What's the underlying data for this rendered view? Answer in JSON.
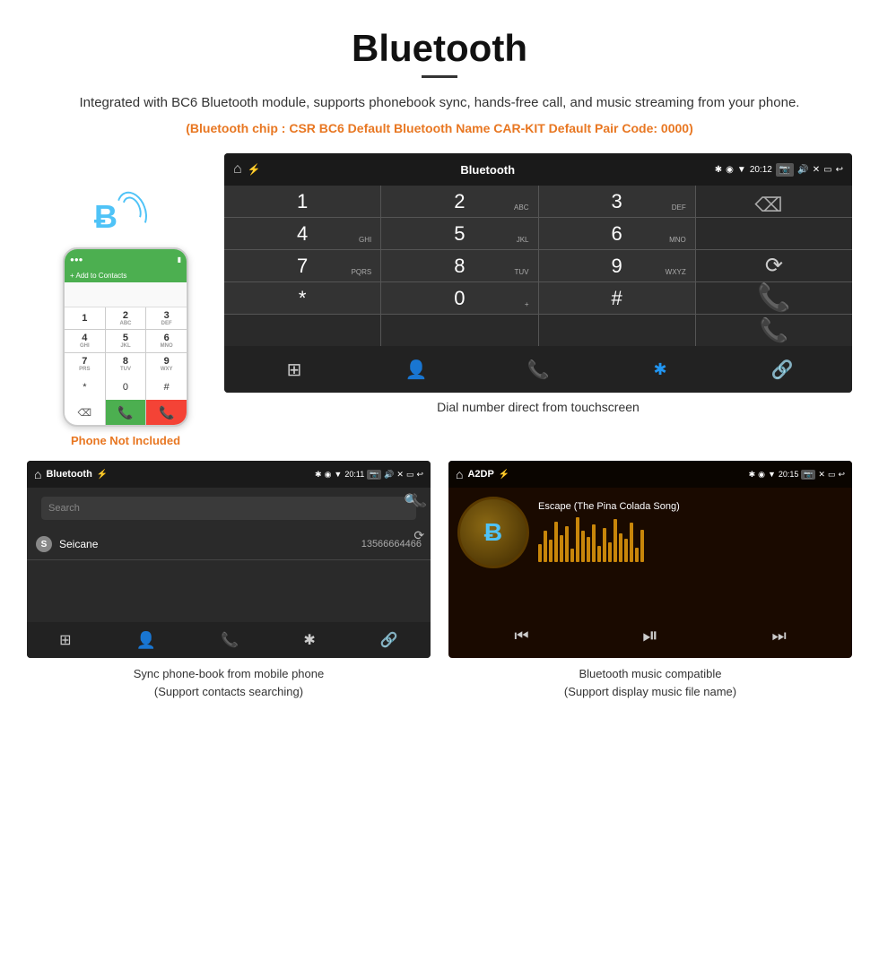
{
  "header": {
    "title": "Bluetooth",
    "description": "Integrated with BC6 Bluetooth module, supports phonebook sync, hands-free call, and music streaming from your phone.",
    "specs": "(Bluetooth chip : CSR BC6    Default Bluetooth Name CAR-KIT    Default Pair Code: 0000)"
  },
  "dial_screen": {
    "status": {
      "app_name": "Bluetooth",
      "time": "20:12"
    },
    "keys": [
      {
        "label": "1",
        "sub": ""
      },
      {
        "label": "2",
        "sub": "ABC"
      },
      {
        "label": "3",
        "sub": "DEF"
      },
      {
        "label": "",
        "type": "empty"
      },
      {
        "label": "4",
        "sub": "GHI"
      },
      {
        "label": "5",
        "sub": "JKL"
      },
      {
        "label": "6",
        "sub": "MNO"
      },
      {
        "label": "",
        "type": "empty"
      },
      {
        "label": "7",
        "sub": "PQRS"
      },
      {
        "label": "8",
        "sub": "TUV"
      },
      {
        "label": "9",
        "sub": "WXYZ"
      },
      {
        "label": "⟳",
        "type": "sync"
      },
      {
        "label": "*",
        "sub": ""
      },
      {
        "label": "0",
        "sub": "+"
      },
      {
        "label": "#",
        "sub": ""
      },
      {
        "label": "✆",
        "type": "call-green"
      },
      {
        "label": "✆",
        "type": "call-red"
      }
    ],
    "caption": "Dial number direct from touchscreen"
  },
  "phonebook_screen": {
    "status": {
      "app_name": "Bluetooth",
      "time": "20:11"
    },
    "search_placeholder": "Search",
    "contacts": [
      {
        "letter": "S",
        "name": "Seicane",
        "number": "13566664466"
      }
    ],
    "caption": "Sync phone-book from mobile phone\n(Support contacts searching)"
  },
  "music_screen": {
    "status": {
      "app_name": "A2DP",
      "time": "20:15"
    },
    "song_title": "Escape (The Pina Colada Song)",
    "caption": "Bluetooth music compatible\n(Support display music file name)"
  },
  "phone_not_included": "Phone Not Included"
}
